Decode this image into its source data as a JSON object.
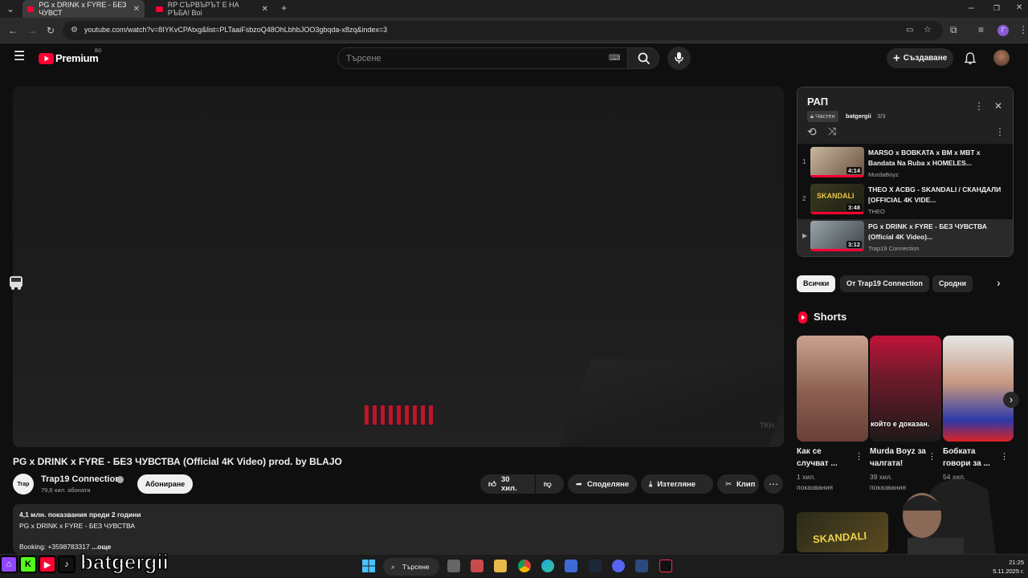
{
  "browser": {
    "tabs": [
      {
        "label": "PG x DRINK x FYRE - БЕЗ ЧУВСТ",
        "active": true
      },
      {
        "label": "RP СЪРВЪРЪТ Е НА РЪБА! Воі",
        "active": false
      }
    ],
    "url": "youtube.com/watch?v=8IYKvCPAtxg&list=PLTaaiFsbzoQ48OhLbhbJOO3gbqda-x8zq&index=3",
    "accent": "#ff0033"
  },
  "header": {
    "logo": "Premium",
    "region": "BG",
    "search_placeholder": "Търсене",
    "create_label": "Създаване"
  },
  "video": {
    "title": "PG x DRINK x FYRE - БЕЗ ЧУВСТВА (Official 4K Video) prod. by BLAJO",
    "watermark": "TKH",
    "channel": {
      "name": "Trap19 Connection",
      "subs": "79,6 хил. абонати",
      "avatar_text": "Trap"
    },
    "subscribe_label": "Абониране",
    "likes": "30 хил.",
    "share_label": "Споделяне",
    "download_label": "Изтегляне",
    "clip_label": "Клип",
    "description": {
      "meta": "4,1 млн. показвания  преди 2 години",
      "line1": "PG x DRINK x FYRE - БЕЗ ЧУВСТВА",
      "line2": "Booking: +3598783317",
      "more": "...още"
    }
  },
  "playlist": {
    "title": "РАП",
    "private_label": "Частен",
    "owner": "batgergii",
    "position": "3/3",
    "items": [
      {
        "index": "1",
        "title": "MARSO x BOBKATA x BM x MBT x Bandata Na Ruba x HOMELES...",
        "channel": "MurdaBoyz",
        "duration": "4:14"
      },
      {
        "index": "2",
        "title": "THEO X ACBG - SKANDALI / СКАНДАЛИ [OFFICIAL 4K VIDE...",
        "channel": "THEO",
        "duration": "3:48"
      },
      {
        "index": "▶",
        "title": "PG x DRINK x FYRE - БЕЗ ЧУВСТВА (Official 4K Video)...",
        "channel": "Trap19 Connection",
        "duration": "3:12"
      }
    ]
  },
  "chips": [
    "Всички",
    "От Trap19 Connection",
    "Сродни"
  ],
  "shorts": {
    "label": "Shorts",
    "subtitle_overlay": "който е доказан.",
    "items": [
      {
        "title": "Как се случват ...",
        "views": "1 хил. показвания"
      },
      {
        "title": "Murda Boyz за чалгата!",
        "views": "39 хил. показвания"
      },
      {
        "title": "Бобката говори за ...",
        "views": "54 хил. показвания"
      }
    ]
  },
  "related": {
    "thumb_text": "SKANDALI"
  },
  "overlay": {
    "streamer": "batgergii"
  },
  "taskbar": {
    "search_label": "Търсене",
    "time": "21:25",
    "date": "5.11.2025 г."
  }
}
